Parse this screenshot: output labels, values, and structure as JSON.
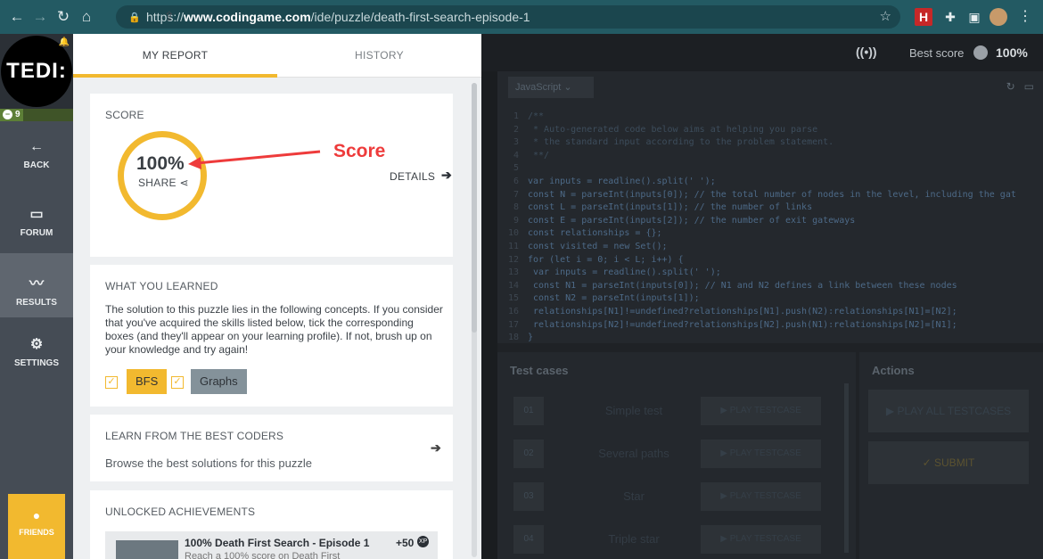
{
  "browser": {
    "back": "←",
    "forward": "→",
    "reload": "↻",
    "home": "⌂",
    "url_prefix": "https://",
    "url_host": "www.codingame.com",
    "url_path": "/ide/puzzle/death-first-search-episode-1"
  },
  "sidebar": {
    "logo": "TEDI:",
    "level": "9",
    "items": [
      {
        "label": "BACK",
        "icon": "back-arrow-icon"
      },
      {
        "label": "FORUM",
        "icon": "forum-icon"
      },
      {
        "label": "RESULTS",
        "icon": "results-icon"
      },
      {
        "label": "SETTINGS",
        "icon": "gear-icon"
      }
    ],
    "friends": "FRIENDS"
  },
  "report": {
    "tabs": [
      "MY REPORT",
      "HISTORY"
    ],
    "score": {
      "title": "SCORE",
      "value": "100%",
      "share": "SHARE",
      "details": "DETAILS",
      "annotation": "Score"
    },
    "learned": {
      "title": "WHAT YOU LEARNED",
      "text": "The solution to this puzzle lies in the following concepts. If you consider that you've acquired the skills listed below, tick the corresponding boxes (and they'll appear on your learning profile). If not, brush up on your knowledge and try again!",
      "tags": [
        "BFS",
        "Graphs"
      ]
    },
    "best": {
      "title": "LEARN FROM THE BEST CODERS",
      "subtitle": "Browse the best solutions for this puzzle"
    },
    "achievements": {
      "title": "UNLOCKED ACHIEVEMENTS",
      "item_name": "100% Death First Search - Episode 1",
      "item_desc": "Reach a 100% score on Death First",
      "item_points": "+50",
      "xp": "XP"
    }
  },
  "ide": {
    "best_score_label": "Best score",
    "best_score_value": "100%",
    "language": "JavaScript",
    "code": [
      {
        "n": "1",
        "t": "/**",
        "c": true
      },
      {
        "n": "2",
        "t": " * Auto-generated code below aims at helping you parse",
        "c": true
      },
      {
        "n": "3",
        "t": " * the standard input according to the problem statement.",
        "c": true
      },
      {
        "n": "4",
        "t": " **/",
        "c": true
      },
      {
        "n": "5",
        "t": "",
        "c": false
      },
      {
        "n": "6",
        "t": "var inputs = readline().split(' ');",
        "c": false
      },
      {
        "n": "7",
        "t": "const N = parseInt(inputs[0]); // the total number of nodes in the level, including the gat",
        "c": false
      },
      {
        "n": "8",
        "t": "const L = parseInt(inputs[1]); // the number of links",
        "c": false
      },
      {
        "n": "9",
        "t": "const E = parseInt(inputs[2]); // the number of exit gateways",
        "c": false
      },
      {
        "n": "10",
        "t": "const relationships = {};",
        "c": false
      },
      {
        "n": "11",
        "t": "const visited = new Set();",
        "c": false
      },
      {
        "n": "12",
        "t": "for (let i = 0; i < L; i++) {",
        "c": false
      },
      {
        "n": "13",
        "t": "    var inputs = readline().split(' ');",
        "c": false
      },
      {
        "n": "14",
        "t": "    const N1 = parseInt(inputs[0]); // N1 and N2 defines a link between these nodes",
        "c": false
      },
      {
        "n": "15",
        "t": "    const N2 = parseInt(inputs[1]);",
        "c": false
      },
      {
        "n": "16",
        "t": "    relationships[N1]!=undefined?relationships[N1].push(N2):relationships[N1]=[N2];",
        "c": false
      },
      {
        "n": "17",
        "t": "    relationships[N2]!=undefined?relationships[N2].push(N1):relationships[N2]=[N1];",
        "c": false
      },
      {
        "n": "18",
        "t": "}",
        "c": false
      }
    ],
    "tests_title": "Test cases",
    "tests": [
      {
        "num": "01",
        "name": "Simple test",
        "play": "▶ PLAY TESTCASE"
      },
      {
        "num": "02",
        "name": "Several paths",
        "play": "▶ PLAY TESTCASE"
      },
      {
        "num": "03",
        "name": "Star",
        "play": "▶ PLAY TESTCASE"
      },
      {
        "num": "04",
        "name": "Triple star",
        "play": "▶ PLAY TESTCASE"
      }
    ],
    "actions_title": "Actions",
    "play_all": "▶ PLAY ALL TESTCASES",
    "submit": "✓ SUBMIT"
  },
  "colors": {
    "accent": "#f2b92f",
    "annotation": "#ee3b3b",
    "chrome": "#235a63"
  }
}
